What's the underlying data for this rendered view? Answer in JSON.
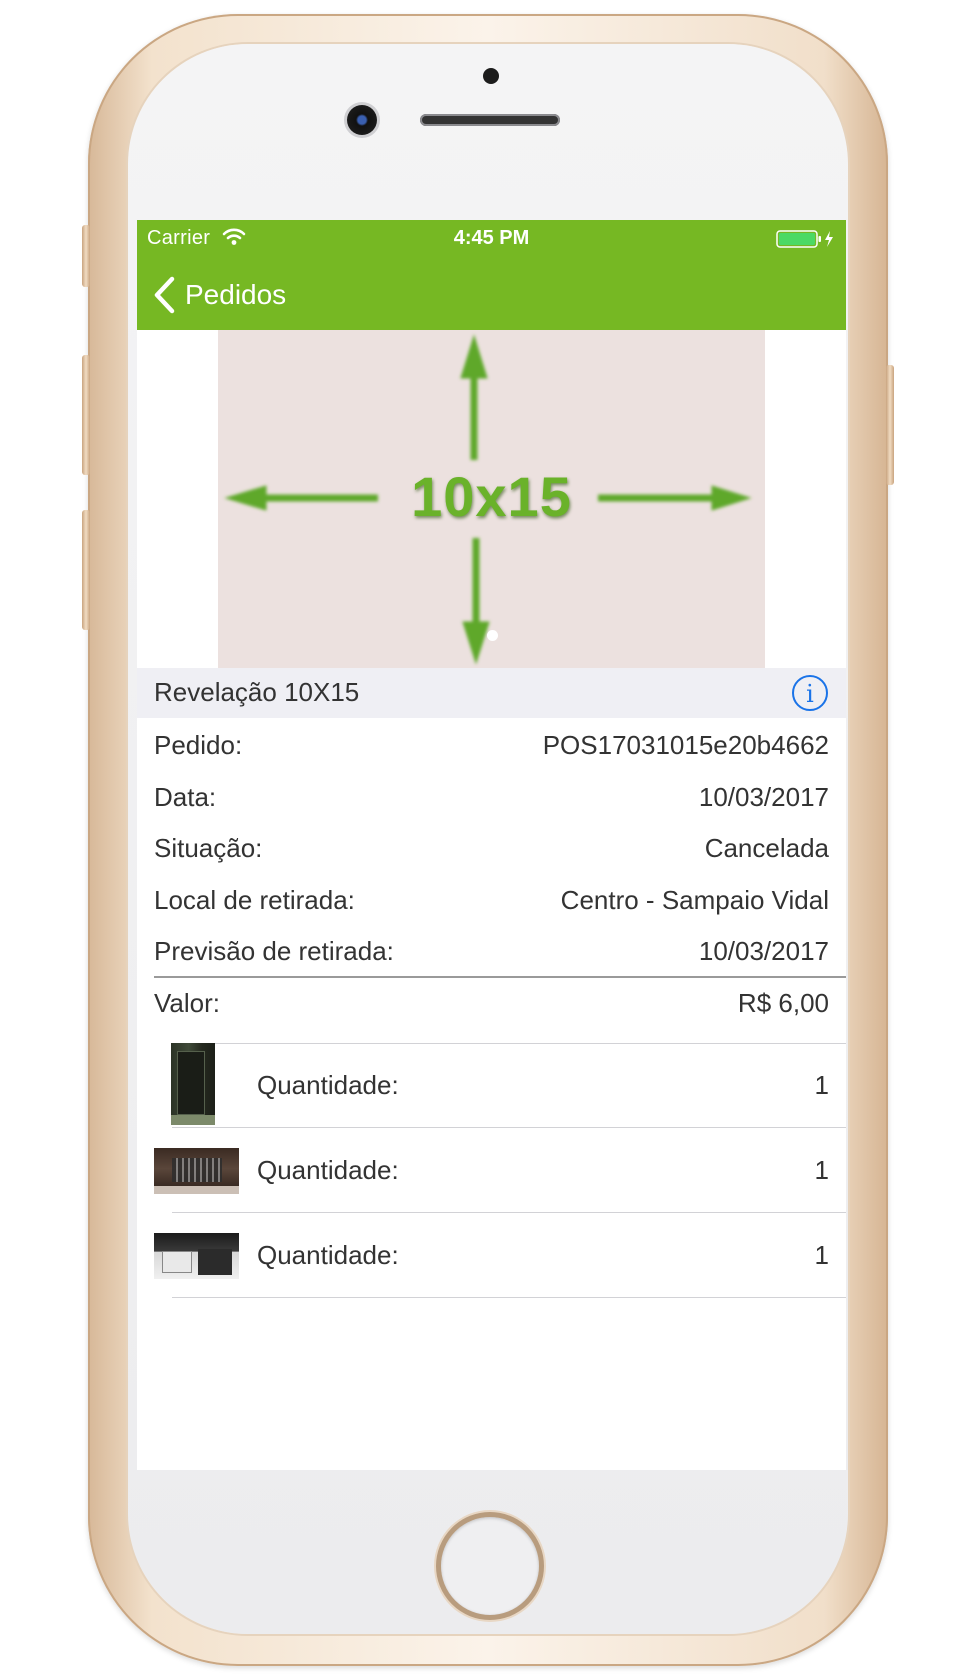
{
  "status_bar": {
    "carrier": "Carrier",
    "time": "4:45 PM"
  },
  "nav": {
    "back_label": "Pedidos",
    "accent_color": "#76b823"
  },
  "banner": {
    "text": "10x15",
    "icon": "arrows-in-four-directions"
  },
  "section": {
    "title": "Revelação 10X15",
    "info_icon": "info-icon"
  },
  "details": [
    {
      "label": "Pedido:",
      "value": "POS17031015e20b4662"
    },
    {
      "label": "Data:",
      "value": "10/03/2017"
    },
    {
      "label": "Situação:",
      "value": "Cancelada"
    },
    {
      "label": "Local de retirada:",
      "value": "Centro - Sampaio Vidal"
    },
    {
      "label": "Previsão de retirada:",
      "value": "10/03/2017"
    },
    {
      "label": "Valor:",
      "value": "R$ 6,00"
    }
  ],
  "items": [
    {
      "label": "Quantidade:",
      "value": "1"
    },
    {
      "label": "Quantidade:",
      "value": "1"
    },
    {
      "label": "Quantidade:",
      "value": "1"
    }
  ]
}
